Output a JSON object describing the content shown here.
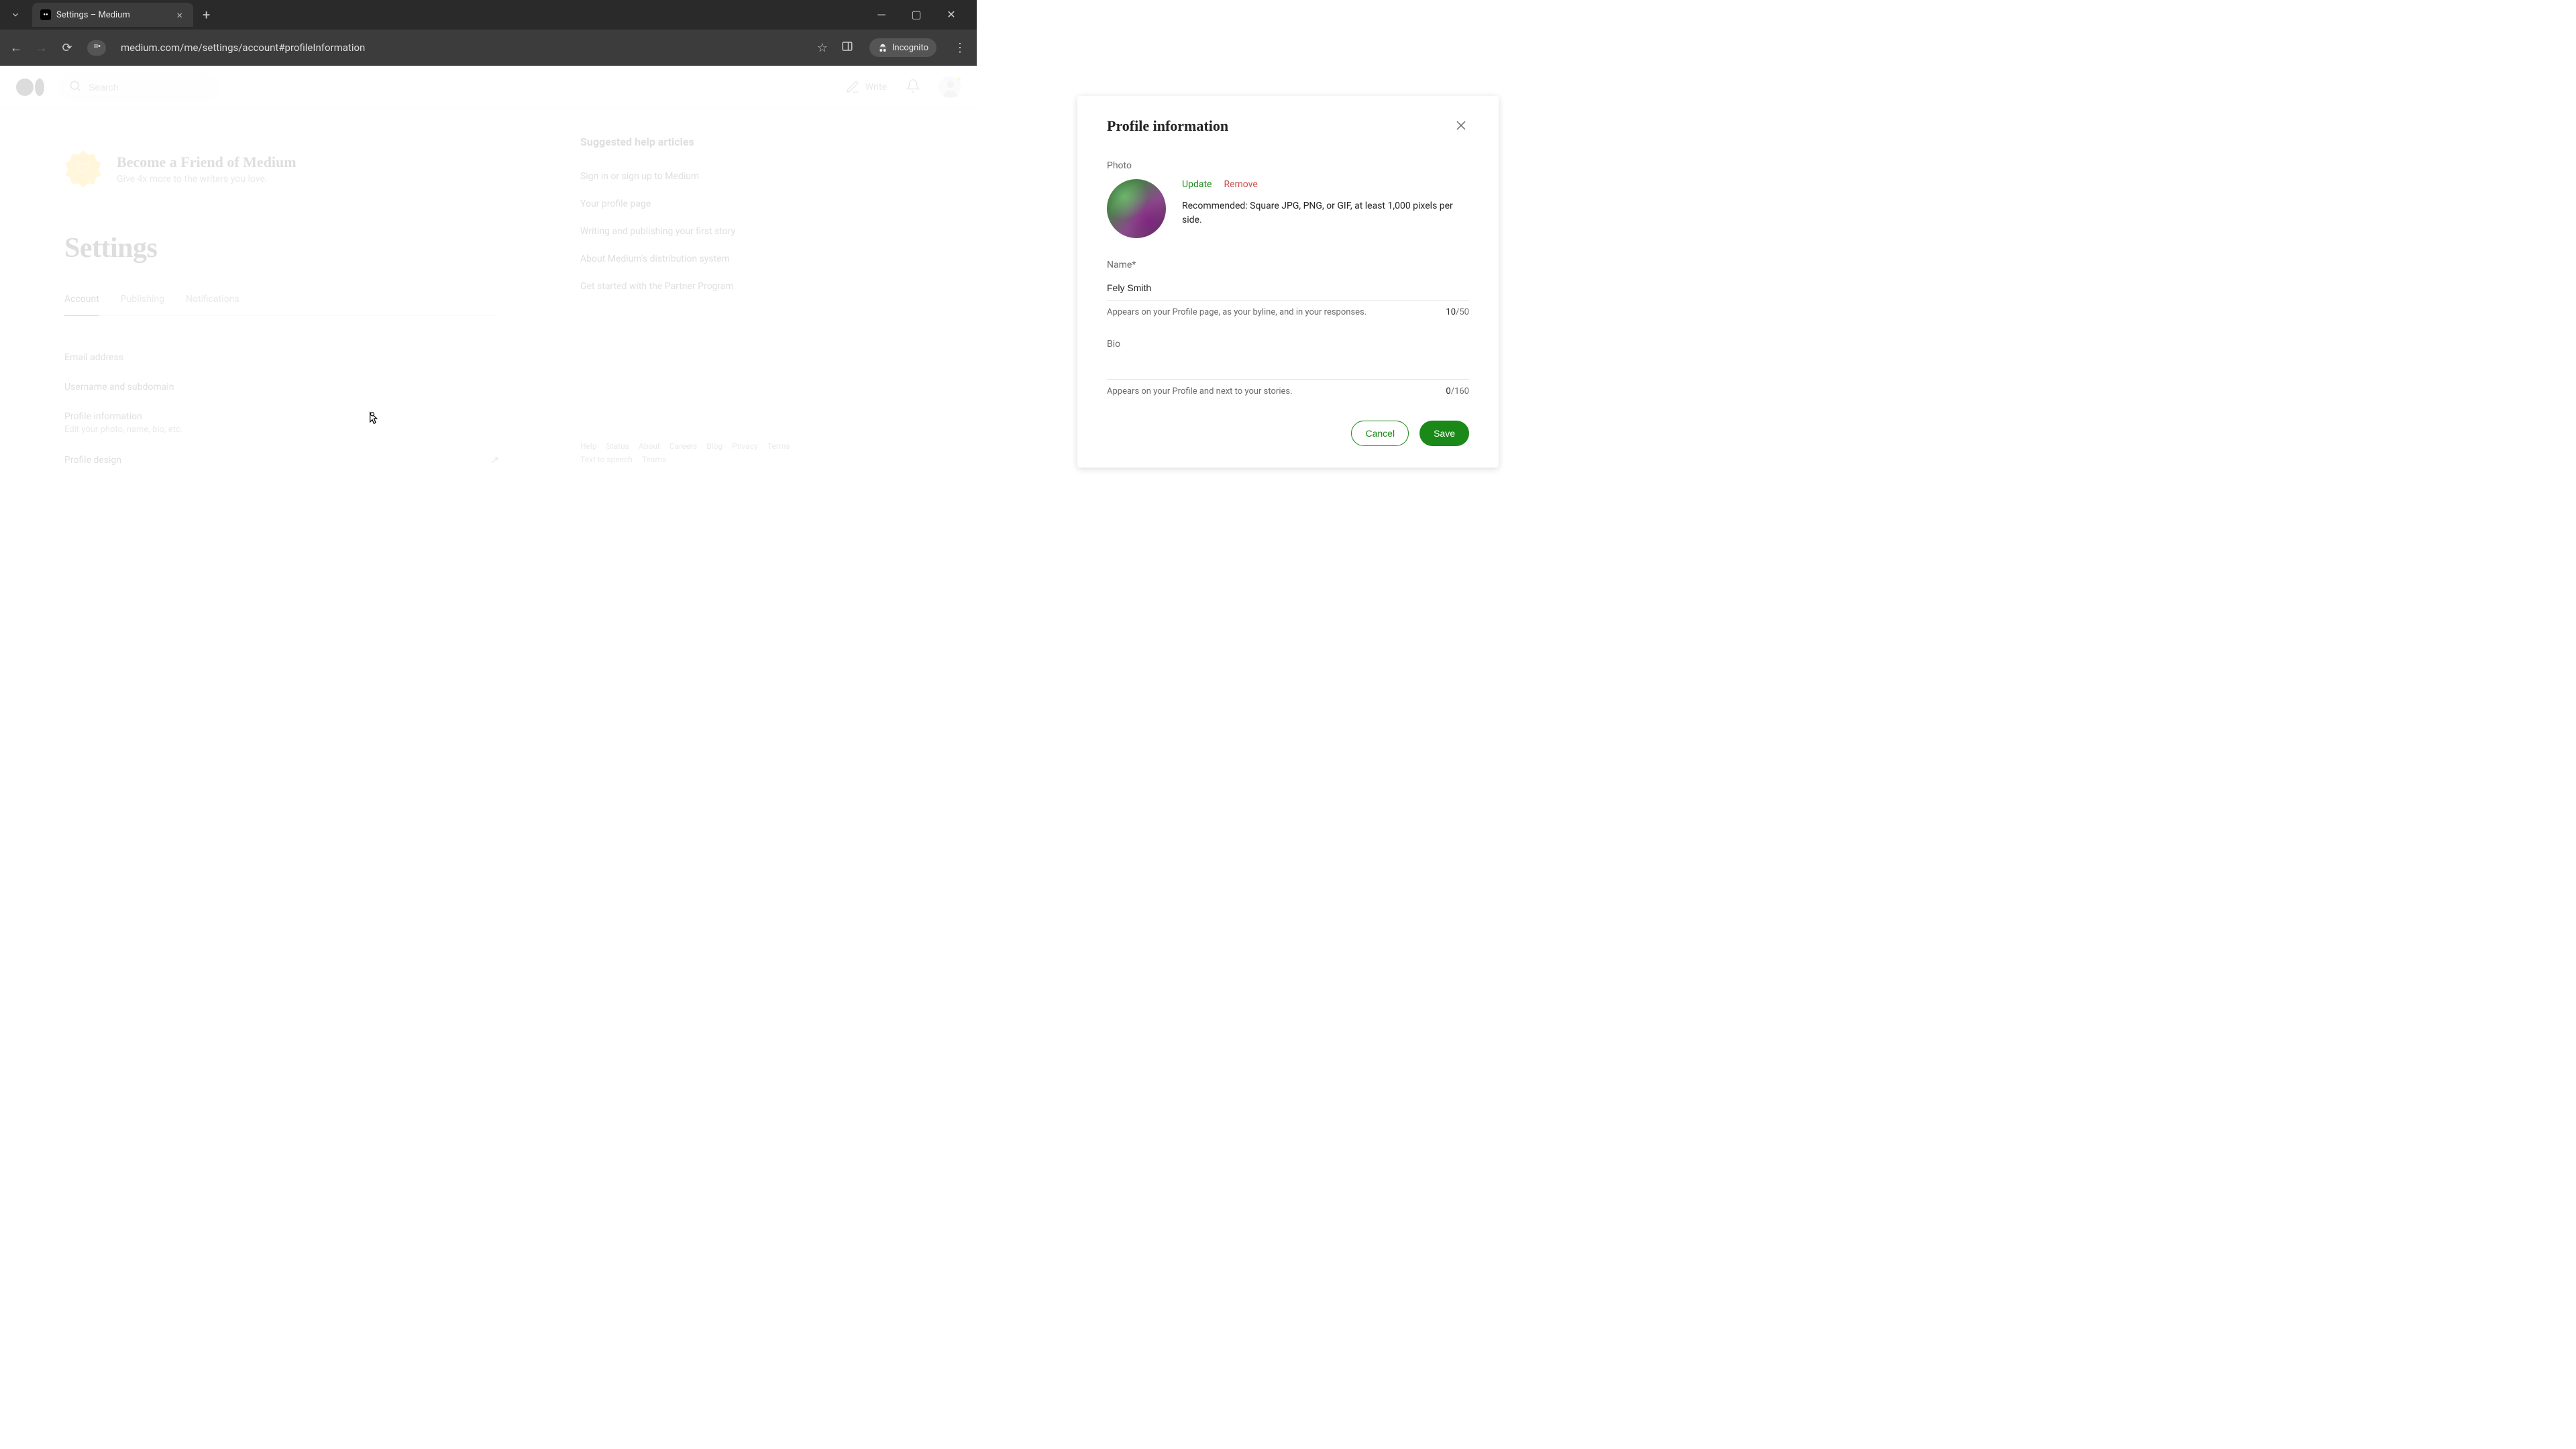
{
  "browser": {
    "tab_title": "Settings – Medium",
    "url": "medium.com/me/settings/account#profileInformation",
    "incognito_label": "Incognito"
  },
  "header": {
    "search_placeholder": "Search",
    "write_label": "Write"
  },
  "promo": {
    "title": "Become a Friend of Medium",
    "subtitle": "Give 4x more to the writers you love."
  },
  "page": {
    "title": "Settings",
    "tabs": [
      "Account",
      "Publishing",
      "Notifications"
    ],
    "active_tab": 0,
    "rows": {
      "email": "Email address",
      "username": "Username and subdomain",
      "profile_info": "Profile information",
      "profile_info_sub": "Edit your photo, name, bio, etc.",
      "profile_design": "Profile design"
    }
  },
  "sidebar": {
    "heading": "Suggested help articles",
    "links": [
      "Sign in or sign up to Medium",
      "Your profile page",
      "Writing and publishing your first story",
      "About Medium's distribution system",
      "Get started with the Partner Program"
    ]
  },
  "footer": [
    "Help",
    "Status",
    "About",
    "Careers",
    "Blog",
    "Privacy",
    "Terms",
    "Text to speech",
    "Teams"
  ],
  "dialog": {
    "title": "Profile information",
    "photo_label": "Photo",
    "update": "Update",
    "remove": "Remove",
    "photo_hint": "Recommended: Square JPG, PNG, or GIF, at least 1,000 pixels per side.",
    "name_label": "Name*",
    "name_value": "Fely Smith",
    "name_hint": "Appears on your Profile page, as your byline, and in your responses.",
    "name_count": "10",
    "name_max": "/50",
    "bio_label": "Bio",
    "bio_value": "",
    "bio_hint": "Appears on your Profile and next to your stories.",
    "bio_count": "0",
    "bio_max": "/160",
    "cancel": "Cancel",
    "save": "Save"
  }
}
